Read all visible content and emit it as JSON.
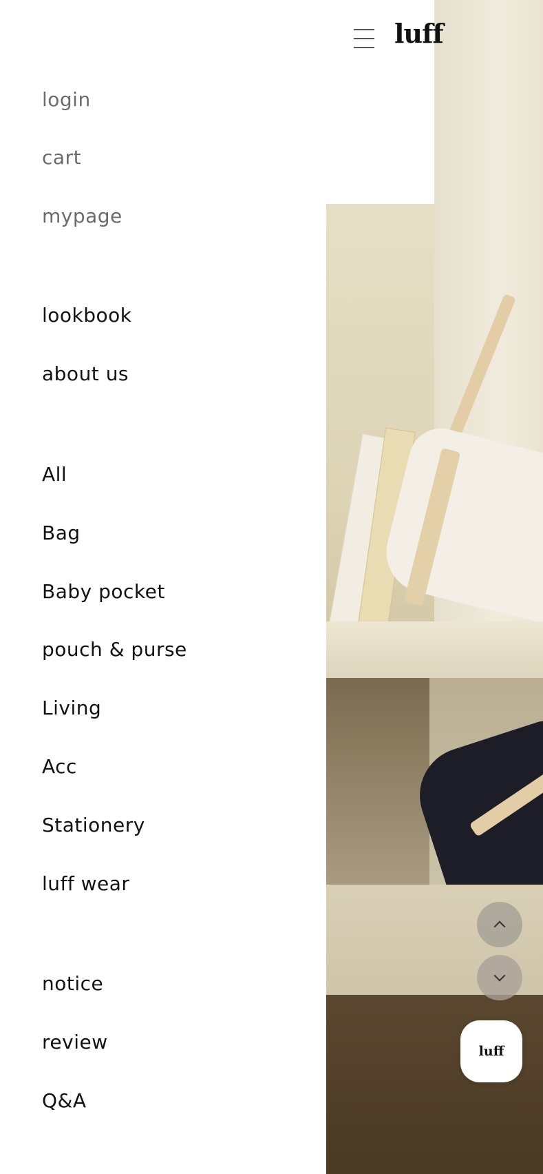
{
  "header": {
    "logo_text": "luff",
    "menu_icon": "hamburger-menu-icon"
  },
  "drawer": {
    "account_links": [
      {
        "label": "login"
      },
      {
        "label": "cart"
      },
      {
        "label": "mypage"
      }
    ],
    "brand_links": [
      {
        "label": "lookbook"
      },
      {
        "label": "about us"
      }
    ],
    "category_links": [
      {
        "label": "All"
      },
      {
        "label": "Bag"
      },
      {
        "label": "Baby pocket"
      },
      {
        "label": "pouch & purse"
      },
      {
        "label": "Living"
      },
      {
        "label": "Acc"
      },
      {
        "label": "Stationery"
      },
      {
        "label": "luff wear"
      }
    ],
    "board_links": [
      {
        "label": "notice"
      },
      {
        "label": "review"
      },
      {
        "label": "Q&A"
      }
    ]
  },
  "floating": {
    "scroll_up_icon": "chevron-up-icon",
    "scroll_down_icon": "chevron-down-icon",
    "badge_text": "luff"
  },
  "colors": {
    "muted_text": "#6b6b6b",
    "primary_text": "#111111"
  }
}
